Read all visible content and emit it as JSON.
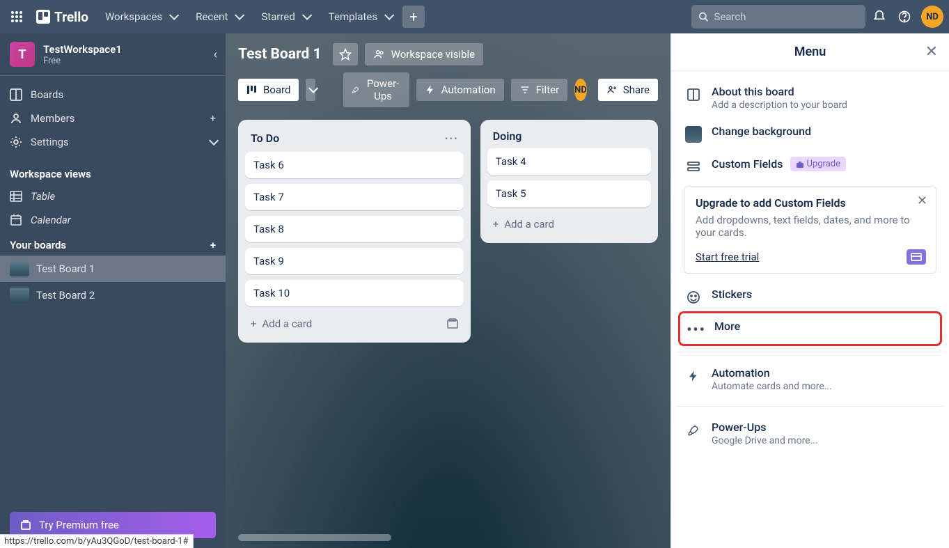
{
  "topnav": {
    "logo": "Trello",
    "items": [
      "Workspaces",
      "Recent",
      "Starred",
      "Templates"
    ],
    "search_placeholder": "Search",
    "avatar": "ND"
  },
  "sidebar": {
    "workspace_badge": "T",
    "workspace_name": "TestWorkspace1",
    "workspace_plan": "Free",
    "nav": {
      "boards": "Boards",
      "members": "Members",
      "settings": "Settings"
    },
    "views_title": "Workspace views",
    "views": {
      "table": "Table",
      "calendar": "Calendar"
    },
    "boards_title": "Your boards",
    "boards": [
      "Test Board 1",
      "Test Board 2"
    ],
    "premium": "Try Premium free"
  },
  "board": {
    "title": "Test Board 1",
    "visibility": "Workspace visible",
    "view_btn": "Board",
    "powerups": "Power-Ups",
    "automation": "Automation",
    "filter": "Filter",
    "member": "ND",
    "share": "Share",
    "lists": [
      {
        "title": "To Do",
        "cards": [
          "Task 6",
          "Task 7",
          "Task 8",
          "Task 9",
          "Task 10"
        ],
        "add": "Add a card"
      },
      {
        "title": "Doing",
        "cards": [
          "Task 4",
          "Task 5"
        ],
        "add": "Add a card"
      }
    ]
  },
  "menu": {
    "title": "Menu",
    "about_title": "About this board",
    "about_sub": "Add a description to your board",
    "change_bg": "Change background",
    "custom_fields": "Custom Fields",
    "upgrade_badge": "Upgrade",
    "upgrade_card": {
      "title": "Upgrade to add Custom Fields",
      "text": "Add dropdowns, text fields, dates, and more to your cards.",
      "link": "Start free trial"
    },
    "stickers": "Stickers",
    "more": "More",
    "automation_title": "Automation",
    "automation_sub": "Automate cards and more...",
    "powerups_title": "Power-Ups",
    "powerups_sub": "Google Drive and more..."
  },
  "status_url": "https://trello.com/b/yAu3QGoD/test-board-1#"
}
